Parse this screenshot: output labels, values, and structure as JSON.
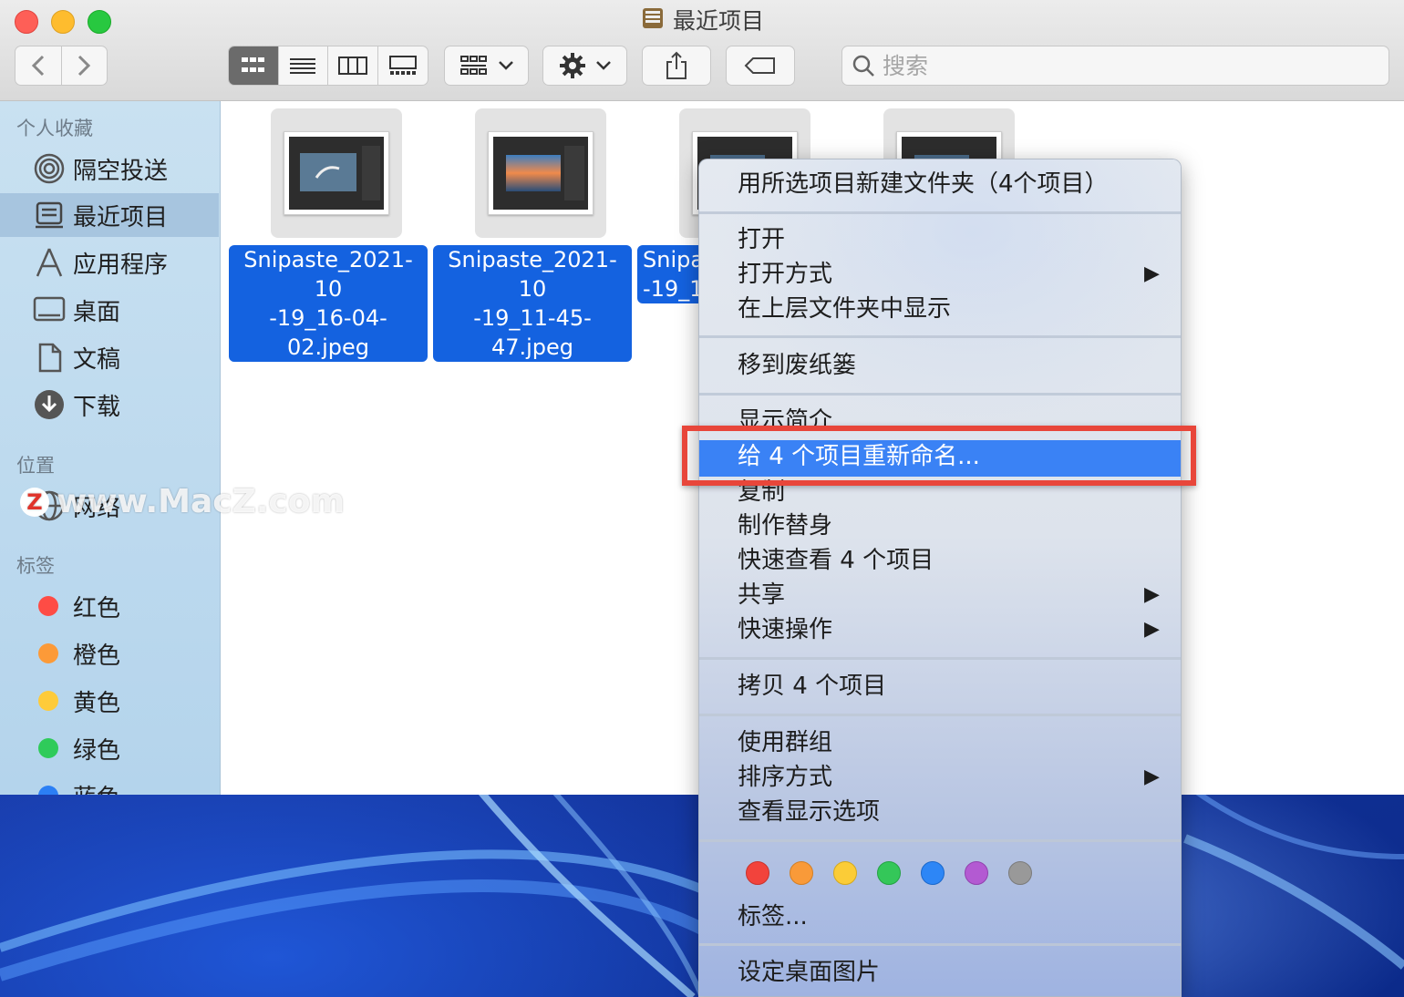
{
  "window": {
    "title": "最近项目"
  },
  "search": {
    "placeholder": "搜索"
  },
  "sidebar": {
    "favorites_header": "个人收藏",
    "favorites": [
      {
        "label": "隔空投送",
        "icon": "airdrop-icon"
      },
      {
        "label": "最近项目",
        "icon": "recents-icon",
        "selected": true
      },
      {
        "label": "应用程序",
        "icon": "applications-icon"
      },
      {
        "label": "桌面",
        "icon": "desktop-icon"
      },
      {
        "label": "文稿",
        "icon": "documents-icon"
      },
      {
        "label": "下载",
        "icon": "downloads-icon"
      }
    ],
    "locations_header": "位置",
    "locations": [
      {
        "label": "网络",
        "icon": "network-icon"
      }
    ],
    "tags_header": "标签",
    "tags": [
      {
        "label": "红色",
        "color": "#fe4c45"
      },
      {
        "label": "橙色",
        "color": "#fc9a38"
      },
      {
        "label": "黄色",
        "color": "#fecb3a"
      },
      {
        "label": "绿色",
        "color": "#2fcb5a"
      },
      {
        "label": "蓝色",
        "color": "#2b7ff5"
      }
    ]
  },
  "files": [
    {
      "name": "Snipaste_2021-10\n-19_16-04-02.jpeg"
    },
    {
      "name": "Snipaste_2021-10\n-19_11-45-47.jpeg"
    },
    {
      "name": "Snipa\n-19_1"
    },
    {
      "name": ""
    }
  ],
  "watermark": {
    "logo": "Z",
    "text": "www.MacZ.com"
  },
  "context_menu": {
    "new_folder": "用所选项目新建文件夹（4个项目）",
    "open": "打开",
    "open_with": "打开方式",
    "show_in_enclosing": "在上层文件夹中显示",
    "move_to_trash": "移到废纸篓",
    "get_info": "显示简介",
    "rename": "给 4 个项目重新命名...",
    "duplicate": "复制",
    "make_alias": "制作替身",
    "quick_look": "快速查看 4 个项目",
    "share": "共享",
    "quick_actions": "快速操作",
    "copy_items": "拷贝 4 个项目",
    "use_groups": "使用群组",
    "sort_by": "排序方式",
    "show_view_options": "查看显示选项",
    "tag_colors": [
      "#f2433c",
      "#f99a39",
      "#fbcc37",
      "#34c759",
      "#2d86f6",
      "#b35ad2",
      "#999999"
    ],
    "tags": "标签...",
    "set_desktop_picture": "设定桌面图片",
    "submenu_arrow": "▶"
  }
}
